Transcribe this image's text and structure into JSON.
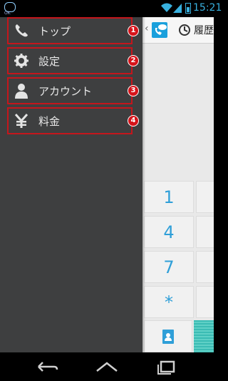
{
  "status_bar": {
    "app_badge_text": "OK",
    "time": "15:21",
    "accent_color": "#38b0de",
    "icons": [
      "app-notification-icon",
      "wifi-icon",
      "signal-icon",
      "battery-icon"
    ]
  },
  "drawer": {
    "items": [
      {
        "label": "トップ",
        "icon": "phone-icon",
        "badge": "1"
      },
      {
        "label": "設定",
        "icon": "gear-icon",
        "badge": "2"
      },
      {
        "label": "アカウント",
        "icon": "person-icon",
        "badge": "3"
      },
      {
        "label": "料金",
        "icon": "yen-icon",
        "badge": "4"
      }
    ],
    "highlight_color": "#c4161c"
  },
  "content": {
    "history_tab_label": "履歴",
    "dialpad_keys": [
      "1",
      "4",
      "7",
      "*"
    ],
    "key_color": "#2f9fd8"
  },
  "nav_bar": {
    "icons": [
      "back-icon",
      "home-icon",
      "recent-apps-icon"
    ]
  }
}
